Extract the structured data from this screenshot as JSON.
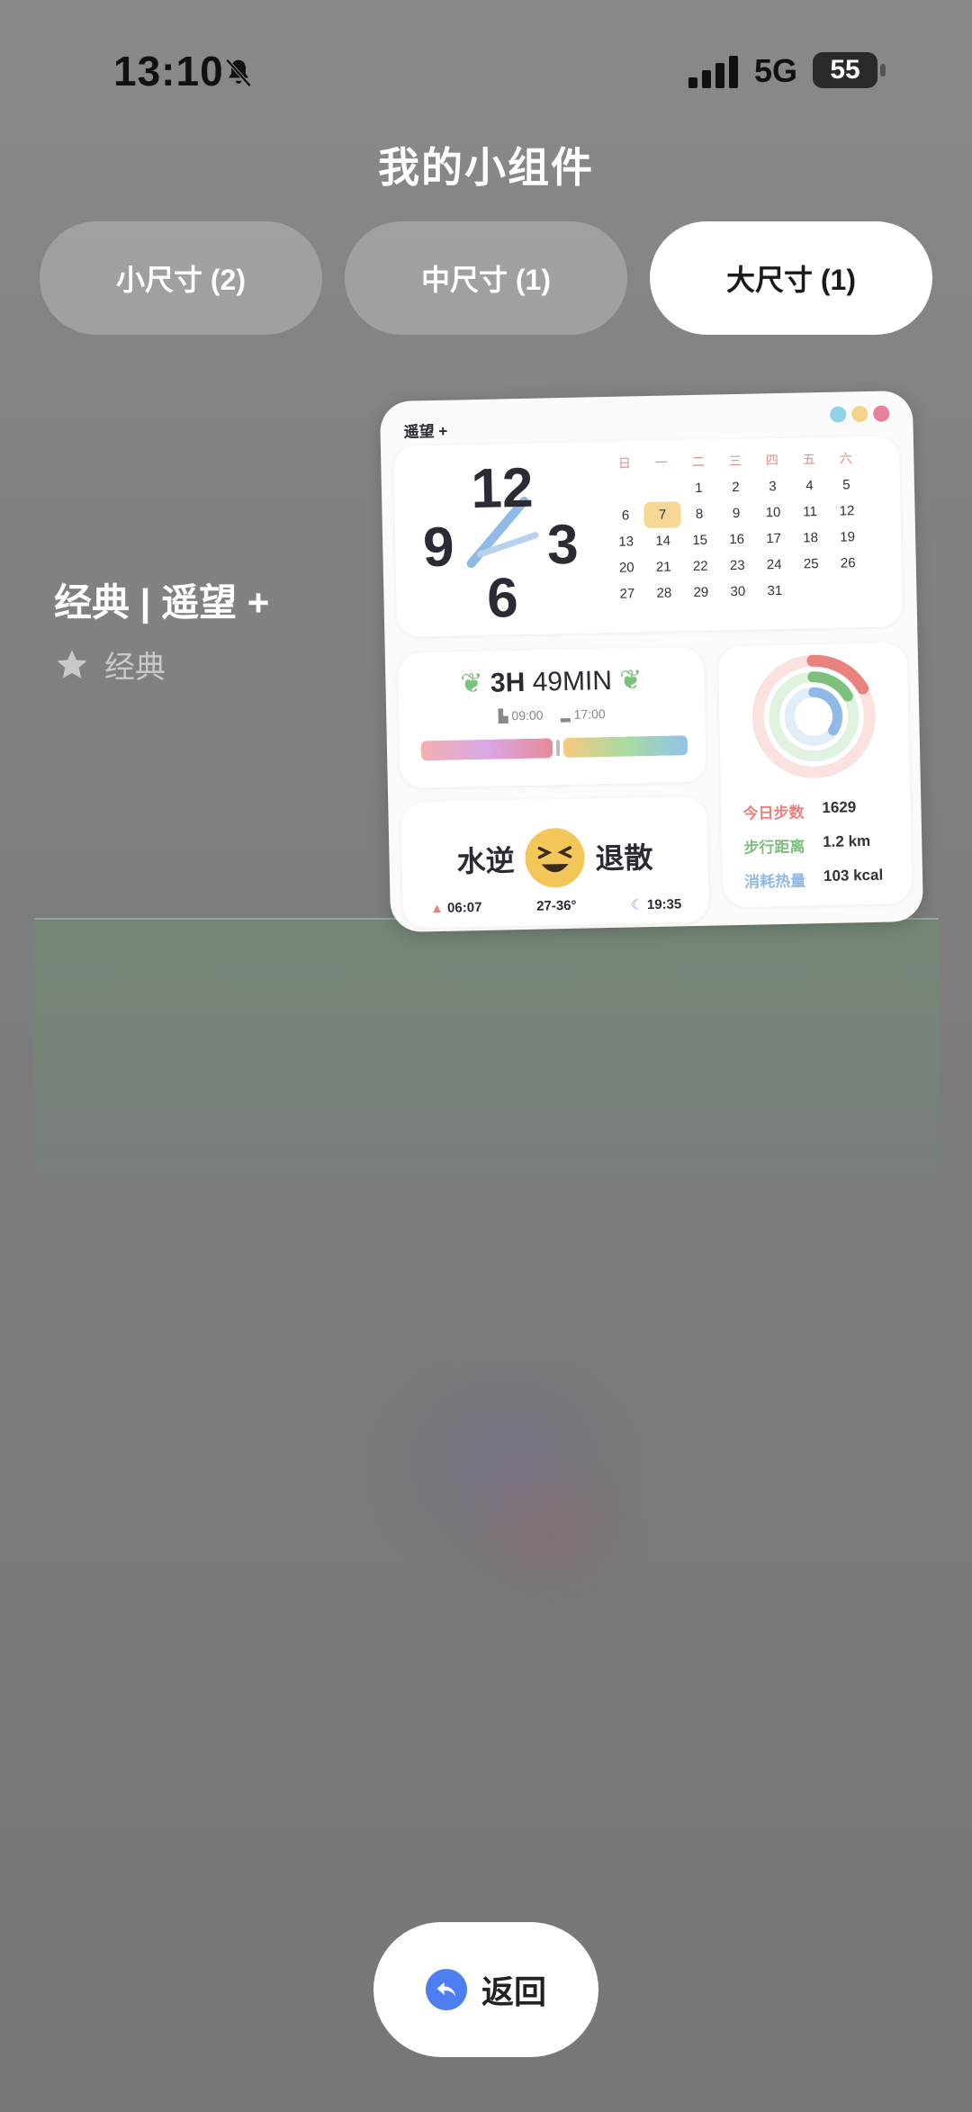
{
  "status": {
    "time": "13:10",
    "network": "5G",
    "battery": "55"
  },
  "page_title": "我的小组件",
  "tabs": [
    {
      "label": "小尺寸 (2)",
      "selected": false
    },
    {
      "label": "中尺寸 (1)",
      "selected": false
    },
    {
      "label": "大尺寸 (1)",
      "selected": true
    }
  ],
  "widget": {
    "name": "经典 | 遥望 +",
    "category": "经典",
    "card_title": "遥望 +",
    "clock_digits": {
      "top": "12",
      "left": "9",
      "right": "3",
      "bottom": "6"
    },
    "calendar": {
      "weekdays": [
        "日",
        "一",
        "二",
        "三",
        "四",
        "五",
        "六"
      ],
      "rows": [
        [
          "",
          "",
          "1",
          "2",
          "3",
          "4",
          "5"
        ],
        [
          "6",
          "7",
          "8",
          "9",
          "10",
          "11",
          "12"
        ],
        [
          "13",
          "14",
          "15",
          "16",
          "17",
          "18",
          "19"
        ],
        [
          "20",
          "21",
          "22",
          "23",
          "24",
          "25",
          "26"
        ],
        [
          "27",
          "28",
          "29",
          "30",
          "31",
          "",
          ""
        ]
      ],
      "today": "7"
    },
    "duration": {
      "hours": "3H",
      "minutes": "49MIN",
      "start": "09:00",
      "end": "17:00"
    },
    "stats": [
      {
        "label": "今日步数",
        "value": "1629",
        "color": "#e8827c"
      },
      {
        "label": "步行距离",
        "value": "1.2 km",
        "color": "#7cc07c"
      },
      {
        "label": "消耗热量",
        "value": "103 kcal",
        "color": "#8fb9e6"
      }
    ],
    "mood": {
      "left": "水逆",
      "right": "退散",
      "sunrise": "06:07",
      "temp": "27-36°",
      "sunset": "19:35"
    },
    "colors": {
      "dot1": "#8fd3e8",
      "dot2": "#f2d48a",
      "dot3": "#e8829a"
    }
  },
  "back_button": {
    "label": "返回"
  }
}
